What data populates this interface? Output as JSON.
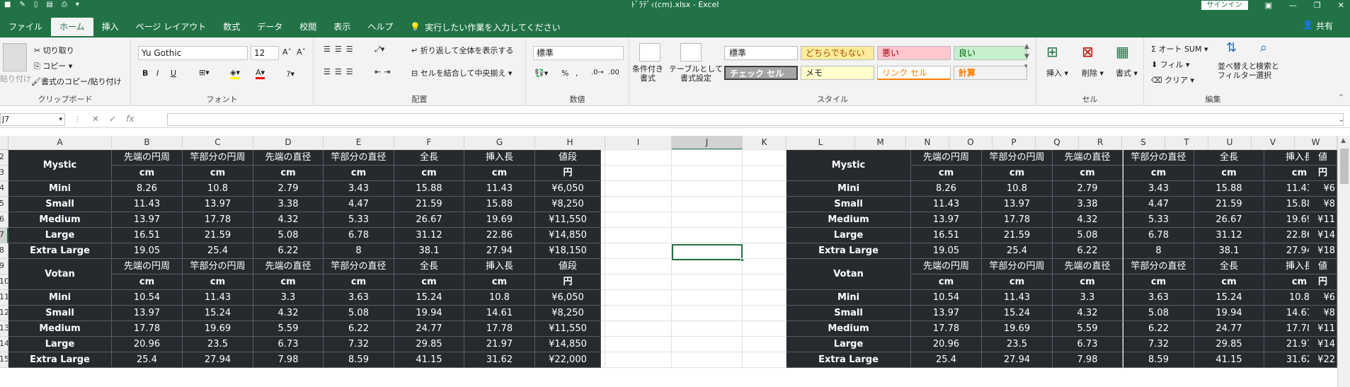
{
  "window": {
    "title": "ﾄﾞﾗﾃﾞｨ(cm).xlsx  -  Excel",
    "signin": "サインイン",
    "share": "共有"
  },
  "tabs": [
    "ファイル",
    "ホーム",
    "挿入",
    "ページ レイアウト",
    "数式",
    "データ",
    "校閲",
    "表示",
    "ヘルプ"
  ],
  "tellme": "実行したい作業を入力してください",
  "ribbon": {
    "clipboard": {
      "paste": "貼り付け",
      "cut": "切り取り",
      "copy": "コピー",
      "format_painter": "書式のコピー/貼り付け",
      "label": "クリップボード"
    },
    "font": {
      "name": "Yu Gothic",
      "size": "12",
      "label": "フォント",
      "bold": "B",
      "italic": "I",
      "underline": "U"
    },
    "alignment": {
      "wrap": "折り返して全体を表示する",
      "merge": "セルを結合して中央揃え",
      "label": "配置"
    },
    "number": {
      "format": "標準",
      "label": "数値",
      "percent": "%",
      "comma": ","
    },
    "styles": {
      "conditional": "条件付き\n書式",
      "table": "テーブルとして\n書式設定",
      "label": "スタイル",
      "cells": [
        {
          "text": "標準",
          "bg": "#ffffff",
          "fg": "#222222"
        },
        {
          "text": "どちらでもない",
          "bg": "#ffeb9c",
          "fg": "#9c5700"
        },
        {
          "text": "悪い",
          "bg": "#ffc7ce",
          "fg": "#9c0006"
        },
        {
          "text": "良い",
          "bg": "#c6efce",
          "fg": "#006100"
        },
        {
          "text": "チェック セル",
          "bg": "#a5a5a5",
          "fg": "#ffffff"
        },
        {
          "text": "メモ",
          "bg": "#ffffcc",
          "fg": "#222222"
        },
        {
          "text": "リンク セル",
          "bg": "#ffffff",
          "fg": "#fa7d00"
        },
        {
          "text": "計算",
          "bg": "#f2f2f2",
          "fg": "#fa7d00"
        }
      ]
    },
    "cells": {
      "insert": "挿入",
      "delete": "削除",
      "format": "書式",
      "label": "セル"
    },
    "editing": {
      "autosum": "オート SUM",
      "fill": "フィル",
      "clear": "クリア",
      "sort": "並べ替えと\nフィルター",
      "find": "検索と\n選択",
      "label": "編集"
    }
  },
  "formula_bar": {
    "namebox": "J7",
    "fx": "fx",
    "value": ""
  },
  "columns": [
    "A",
    "B",
    "C",
    "D",
    "E",
    "F",
    "G",
    "H",
    "I",
    "J",
    "K",
    "L",
    "M",
    "N",
    "O",
    "P",
    "Q",
    "R",
    "S",
    "T",
    "U",
    "V",
    "W"
  ],
  "rows": [
    "2",
    "3",
    "4",
    "5",
    "6",
    "7",
    "8",
    "9",
    "10",
    "11",
    "12",
    "13",
    "14",
    "15"
  ],
  "headers": [
    "先端の円周",
    "竿部分の円周",
    "先端の直径",
    "竿部分の直径",
    "全長",
    "挿入長",
    "値段"
  ],
  "units": [
    "cm",
    "cm",
    "cm",
    "cm",
    "cm",
    "cm",
    "円"
  ],
  "tables": [
    {
      "name": "Mystic",
      "rows": [
        {
          "size": "Mini",
          "vals": [
            "8.26",
            "10.8",
            "2.79",
            "3.43",
            "15.88",
            "11.43",
            "¥6,050"
          ]
        },
        {
          "size": "Small",
          "vals": [
            "11.43",
            "13.97",
            "3.38",
            "4.47",
            "21.59",
            "15.88",
            "¥8,250"
          ]
        },
        {
          "size": "Medium",
          "vals": [
            "13.97",
            "17.78",
            "4.32",
            "5.33",
            "26.67",
            "19.69",
            "¥11,550"
          ]
        },
        {
          "size": "Large",
          "vals": [
            "16.51",
            "21.59",
            "5.08",
            "6.78",
            "31.12",
            "22.86",
            "¥14,850"
          ]
        },
        {
          "size": "Extra Large",
          "vals": [
            "19.05",
            "25.4",
            "6.22",
            "8",
            "38.1",
            "27.94",
            "¥18,150"
          ]
        }
      ]
    },
    {
      "name": "Votan",
      "rows": [
        {
          "size": "Mini",
          "vals": [
            "10.54",
            "11.43",
            "3.3",
            "3.63",
            "15.24",
            "10.8",
            "¥6,050"
          ]
        },
        {
          "size": "Small",
          "vals": [
            "13.97",
            "15.24",
            "4.32",
            "5.08",
            "19.94",
            "14.61",
            "¥8,250"
          ]
        },
        {
          "size": "Medium",
          "vals": [
            "17.78",
            "19.69",
            "5.59",
            "6.22",
            "24.77",
            "17.78",
            "¥11,550"
          ]
        },
        {
          "size": "Large",
          "vals": [
            "20.96",
            "23.5",
            "6.73",
            "7.32",
            "29.85",
            "21.97",
            "¥14,850"
          ]
        },
        {
          "size": "Extra Large",
          "vals": [
            "25.4",
            "27.94",
            "7.98",
            "8.59",
            "41.15",
            "31.62",
            "¥22,000"
          ]
        }
      ]
    }
  ],
  "right_truncated": {
    "header": "値",
    "units": "円",
    "mystic": [
      "¥6",
      "¥8",
      "¥11",
      "¥14",
      "¥18"
    ],
    "votan": [
      "¥6",
      "¥8",
      "¥11",
      "¥14",
      "¥22"
    ]
  }
}
